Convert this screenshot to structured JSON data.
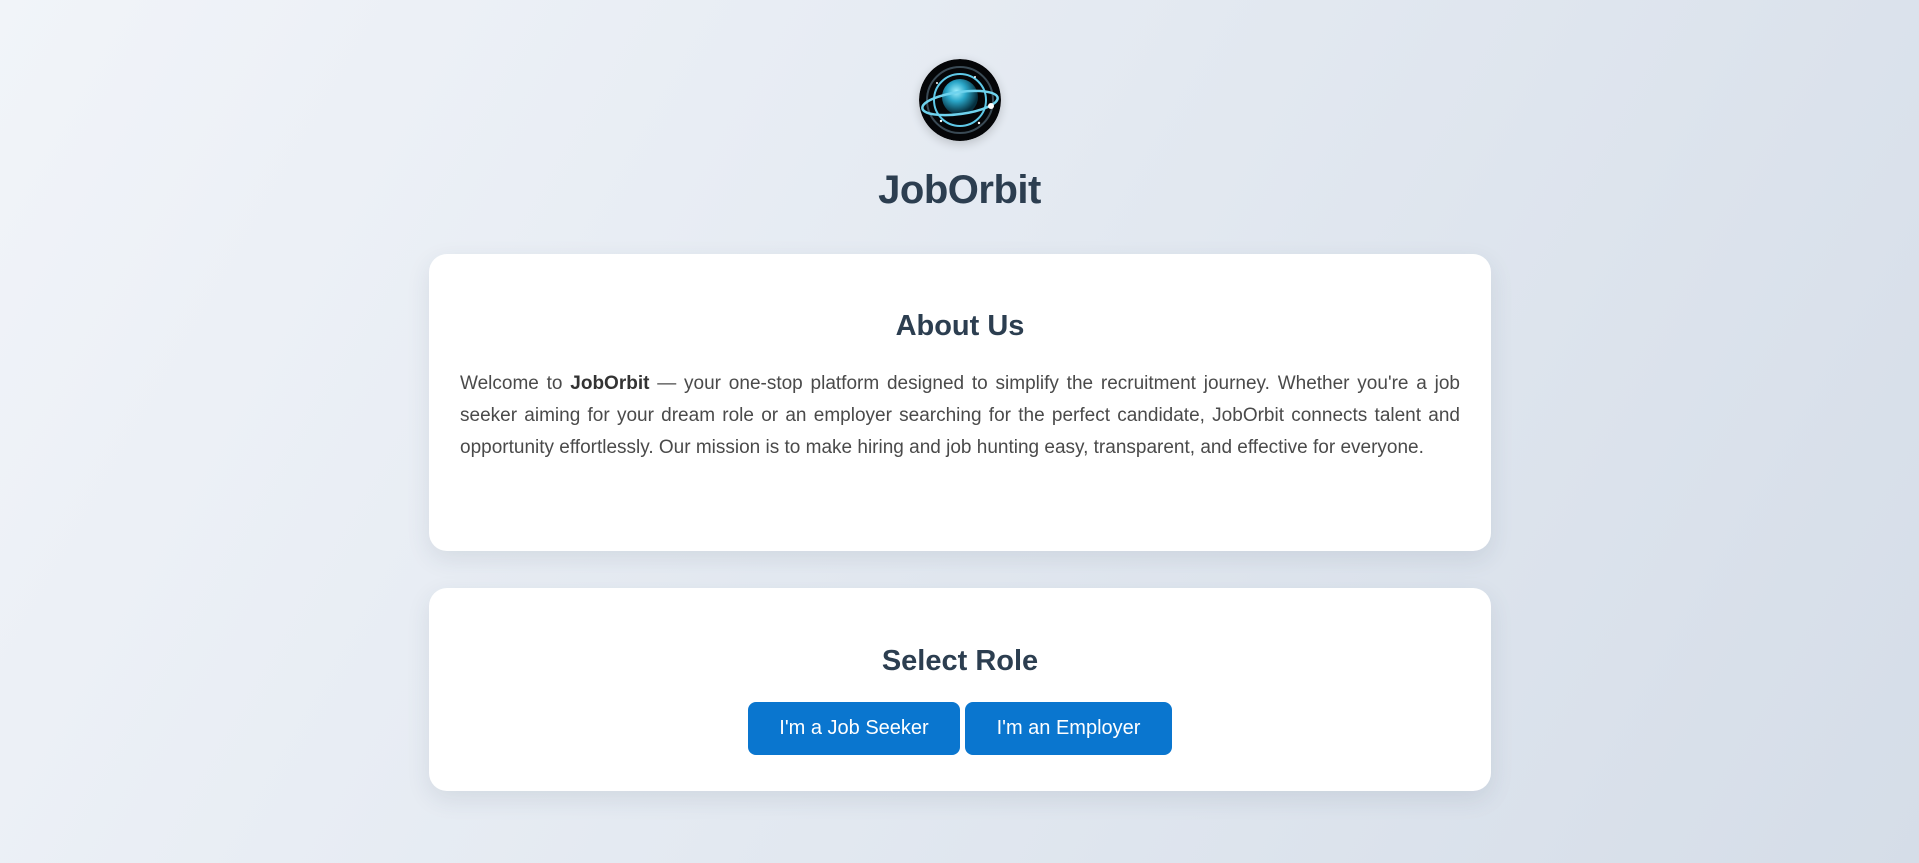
{
  "brand": {
    "name": "JobOrbit",
    "logo_icon": "planet-orbit-logo-icon"
  },
  "about": {
    "title": "About Us",
    "text_intro": "Welcome to ",
    "text_brand": "JobOrbit",
    "text_rest": " — your one-stop platform designed to simplify the recruitment journey. Whether you're a job seeker aiming for your dream role or an employer searching for the perfect candidate, JobOrbit connects talent and opportunity effortlessly. Our mission is to make hiring and job hunting easy, transparent, and effective for everyone."
  },
  "role": {
    "title": "Select Role",
    "seeker_label": "I'm a Job Seeker",
    "employer_label": "I'm an Employer"
  },
  "colors": {
    "button": "#0a76cf",
    "heading": "#2c3e50",
    "body_text": "#4a4a4a",
    "card": "#ffffff"
  }
}
